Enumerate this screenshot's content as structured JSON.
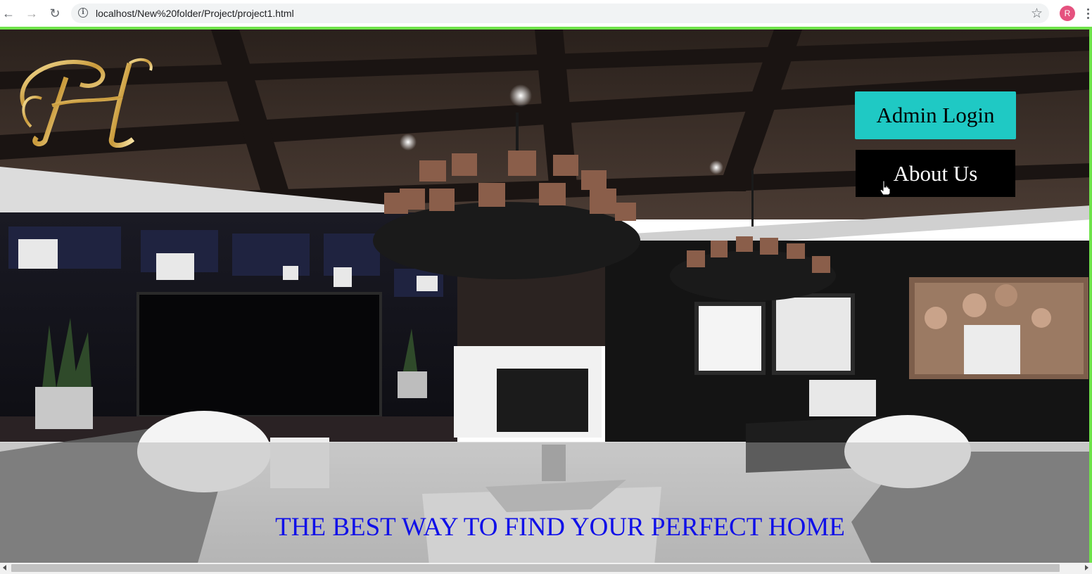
{
  "browser": {
    "url": "localhost/New%20folder/Project/project1.html",
    "profile_initial": "R",
    "profile_color": "#e5527f",
    "icons": [
      "back-arrow-icon",
      "forward-arrow-icon",
      "reload-icon",
      "info-icon",
      "bookmark-star-icon",
      "more-menu-icon"
    ]
  },
  "page": {
    "logo_letter": "H",
    "nav": {
      "admin_login": "Admin Login",
      "about_us": "About Us"
    },
    "tagline": "THE BEST WAY TO FIND YOUR PERFECT HOME",
    "colors": {
      "admin_button": "#1fc9c4",
      "about_button": "#000000",
      "tagline": "#1010e8",
      "frame_border": "#6fe34a"
    }
  }
}
